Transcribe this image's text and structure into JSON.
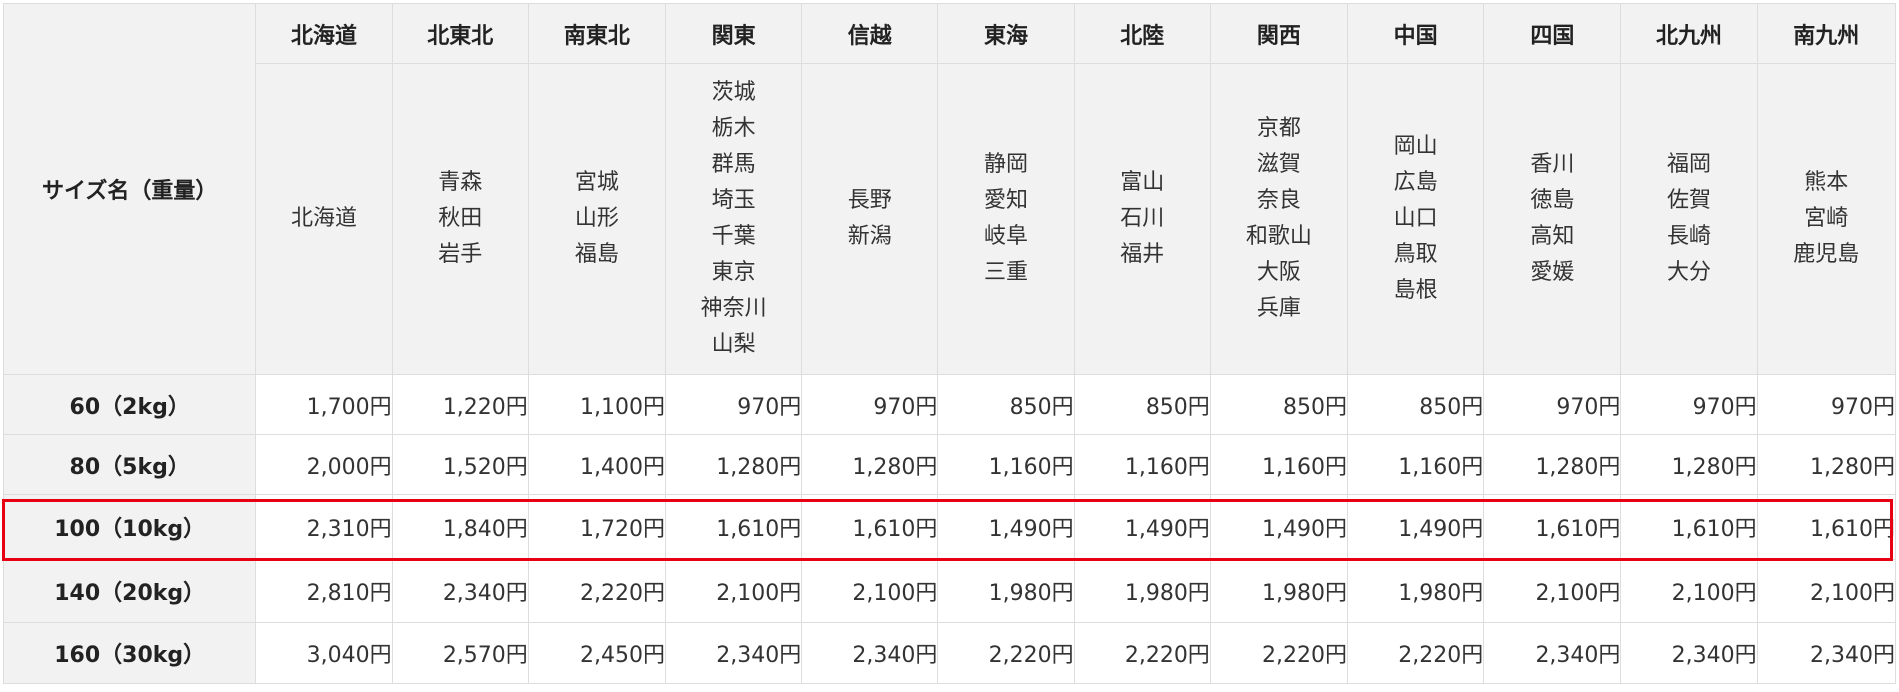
{
  "table": {
    "corner_label": "サイズ名（重量）",
    "regions": [
      {
        "name": "北海道",
        "prefectures": [
          "北海道"
        ]
      },
      {
        "name": "北東北",
        "prefectures": [
          "青森",
          "秋田",
          "岩手"
        ]
      },
      {
        "name": "南東北",
        "prefectures": [
          "宮城",
          "山形",
          "福島"
        ]
      },
      {
        "name": "関東",
        "prefectures": [
          "茨城",
          "栃木",
          "群馬",
          "埼玉",
          "千葉",
          "東京",
          "神奈川",
          "山梨"
        ]
      },
      {
        "name": "信越",
        "prefectures": [
          "長野",
          "新潟"
        ]
      },
      {
        "name": "東海",
        "prefectures": [
          "静岡",
          "愛知",
          "岐阜",
          "三重"
        ]
      },
      {
        "name": "北陸",
        "prefectures": [
          "富山",
          "石川",
          "福井"
        ]
      },
      {
        "name": "関西",
        "prefectures": [
          "京都",
          "滋賀",
          "奈良",
          "和歌山",
          "大阪",
          "兵庫"
        ]
      },
      {
        "name": "中国",
        "prefectures": [
          "岡山",
          "広島",
          "山口",
          "鳥取",
          "島根"
        ]
      },
      {
        "name": "四国",
        "prefectures": [
          "香川",
          "徳島",
          "高知",
          "愛媛"
        ]
      },
      {
        "name": "北九州",
        "prefectures": [
          "福岡",
          "佐賀",
          "長崎",
          "大分"
        ]
      },
      {
        "name": "南九州",
        "prefectures": [
          "熊本",
          "宮崎",
          "鹿児島"
        ]
      }
    ],
    "rows": [
      {
        "size": "60（2kg）",
        "prices": [
          "1,700円",
          "1,220円",
          "1,100円",
          "970円",
          "970円",
          "850円",
          "850円",
          "850円",
          "850円",
          "970円",
          "970円",
          "970円"
        ]
      },
      {
        "size": "80（5kg）",
        "prices": [
          "2,000円",
          "1,520円",
          "1,400円",
          "1,280円",
          "1,280円",
          "1,160円",
          "1,160円",
          "1,160円",
          "1,160円",
          "1,280円",
          "1,280円",
          "1,280円"
        ]
      },
      {
        "size": "100（10kg）",
        "prices": [
          "2,310円",
          "1,840円",
          "1,720円",
          "1,610円",
          "1,610円",
          "1,490円",
          "1,490円",
          "1,490円",
          "1,490円",
          "1,610円",
          "1,610円",
          "1,610円"
        ]
      },
      {
        "size": "140（20kg）",
        "prices": [
          "2,810円",
          "2,340円",
          "2,220円",
          "2,100円",
          "2,100円",
          "1,980円",
          "1,980円",
          "1,980円",
          "1,980円",
          "2,100円",
          "2,100円",
          "2,100円"
        ]
      },
      {
        "size": "160（30kg）",
        "prices": [
          "3,040円",
          "2,570円",
          "2,450円",
          "2,340円",
          "2,340円",
          "2,220円",
          "2,220円",
          "2,220円",
          "2,220円",
          "2,340円",
          "2,340円",
          "2,340円"
        ]
      }
    ],
    "highlighted_row": "100（10kg）",
    "highlight_color": "#e60012"
  }
}
